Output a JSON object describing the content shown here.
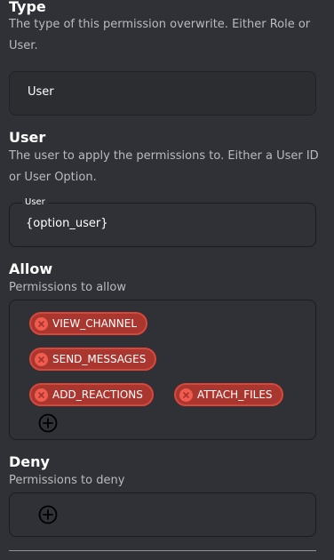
{
  "type_section": {
    "title": "Type",
    "description": "The type of this permission overwrite. Either Role or User.",
    "value": "User"
  },
  "user_section": {
    "title": "User",
    "description": "The user to apply the permissions to. Either a User ID or User Option.",
    "field_label": "User",
    "value": "{option_user}"
  },
  "allow_section": {
    "title": "Allow",
    "description": "Permissions to allow",
    "chips": [
      "VIEW_CHANNEL",
      "SEND_MESSAGES",
      "ADD_REACTIONS",
      "ATTACH_FILES"
    ]
  },
  "deny_section": {
    "title": "Deny",
    "description": "Permissions to deny"
  },
  "colors": {
    "background": "#2f3136",
    "chip_fill": "#a9372f",
    "chip_border": "#d9473b",
    "chip_remove": "#f15c4f"
  },
  "icons": [
    "remove-chip-icon",
    "add-circle-icon"
  ]
}
